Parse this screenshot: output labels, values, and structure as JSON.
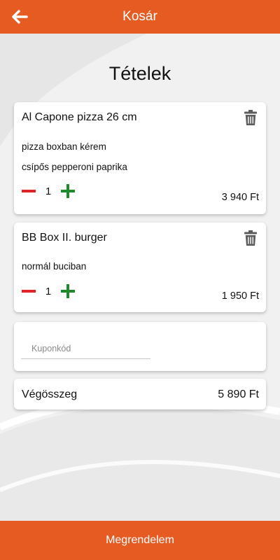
{
  "header": {
    "title": "Kosár",
    "back_icon": "arrow-left-icon",
    "background_color": "#e55b22"
  },
  "main": {
    "heading": "Tételek",
    "items": [
      {
        "name": "Al Capone pizza 26 cm",
        "notes": [
          "pizza boxban kérem",
          "csípős pepperoni paprika"
        ],
        "quantity": "1",
        "price": "3 940 Ft",
        "delete_icon": "trash-icon"
      },
      {
        "name": "BB Box II. burger",
        "notes": [
          "normál buciban"
        ],
        "quantity": "1",
        "price": "1 950 Ft",
        "delete_icon": "trash-icon"
      }
    ],
    "coupon": {
      "placeholder": "Kuponkód",
      "value": ""
    },
    "total": {
      "label": "Végösszeg",
      "value": "5 890 Ft"
    }
  },
  "footer": {
    "order_label": "Megrendelem"
  },
  "colors": {
    "accent": "#e55b22",
    "decrease": "#e0222a",
    "increase": "#1f8a2b",
    "trash": "#5c5c5c"
  }
}
